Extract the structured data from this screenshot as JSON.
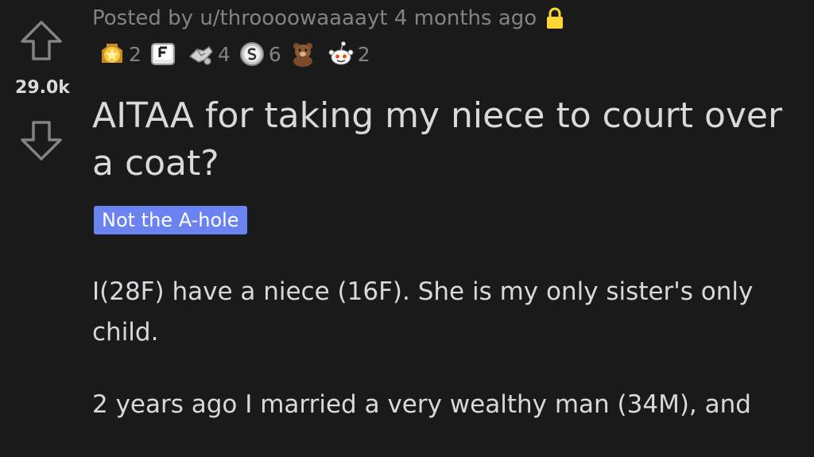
{
  "post": {
    "score": "29.0k",
    "posted_by": "Posted by u/throooowaaaayt 4 months ago",
    "title": "AITAA for taking my niece to court over a coat?",
    "flair": "Not the A-hole",
    "body": [
      "I(28F) have a niece (16F). She is my only sister's only child.",
      "2 years ago I married a very wealthy man (34M), and"
    ]
  },
  "awards": [
    {
      "icon": "gold-star-award-icon",
      "count": "2"
    },
    {
      "icon": "f-key-award-icon",
      "count": ""
    },
    {
      "icon": "handshake-award-icon",
      "count": "4"
    },
    {
      "icon": "silver-coin-award-icon",
      "count": "6"
    },
    {
      "icon": "bear-award-icon",
      "count": ""
    },
    {
      "icon": "snoo-award-icon",
      "count": "2"
    }
  ],
  "colors": {
    "background": "#1a1a1b",
    "text": "#d7dadc",
    "muted": "#818384",
    "flair": "#6b82f1",
    "lock": "#ffd635"
  }
}
